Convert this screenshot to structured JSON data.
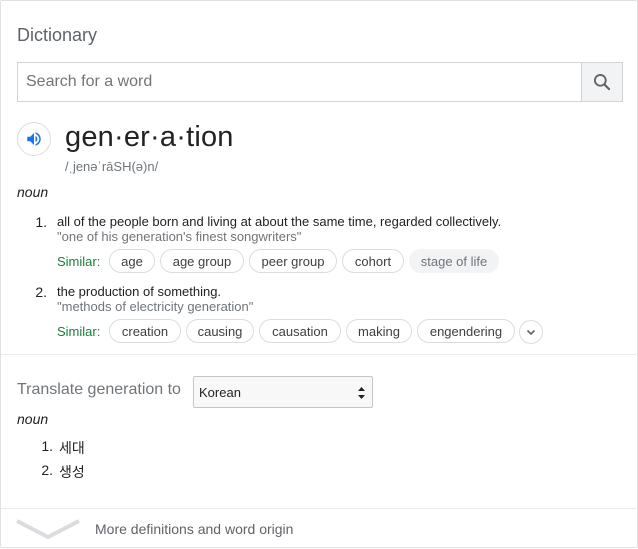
{
  "header": {
    "title": "Dictionary"
  },
  "search": {
    "placeholder": "Search for a word",
    "value": ""
  },
  "entry": {
    "word": "gen·er·a·tion",
    "phonetic": "/ˌjenəˈrāSH(ə)n/",
    "part_of_speech": "noun",
    "senses": [
      {
        "number": "1.",
        "definition": "all of the people born and living at about the same time, regarded collectively.",
        "example": "\"one of his generation's finest songwriters\"",
        "similar_label": "Similar:",
        "similar": [
          "age",
          "age group",
          "peer group",
          "cohort",
          "stage of life"
        ]
      },
      {
        "number": "2.",
        "definition": "the production of something.",
        "example": "\"methods of electricity generation\"",
        "similar_label": "Similar:",
        "similar": [
          "creation",
          "causing",
          "causation",
          "making",
          "engendering"
        ]
      }
    ]
  },
  "translate": {
    "label": "Translate generation to",
    "language": "Korean",
    "part_of_speech": "noun",
    "items": [
      {
        "number": "1.",
        "word": "세대"
      },
      {
        "number": "2.",
        "word": "생성"
      }
    ]
  },
  "footer": {
    "more_label": "More definitions and word origin"
  },
  "icons": {
    "search": "search-icon",
    "speaker": "speaker-icon",
    "expand": "chevron-down-icon",
    "more": "chevron-down-icon"
  },
  "colors": {
    "accent": "#1a73e8",
    "similar": "#188038",
    "muted": "#70757a"
  }
}
